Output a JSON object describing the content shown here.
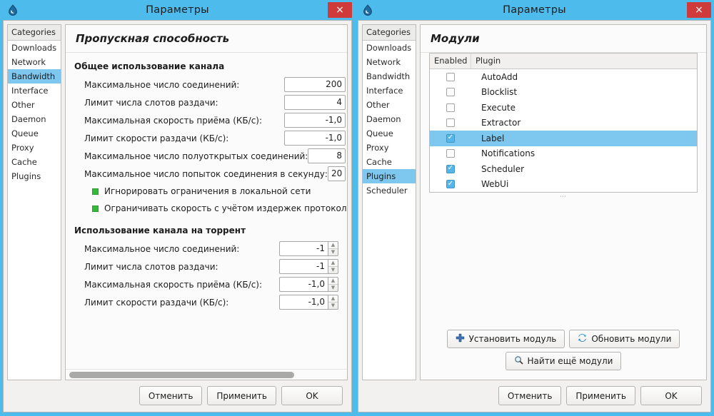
{
  "colors": {
    "titlebar": "#4dbbec",
    "close_button": "#cf3a3a",
    "selection": "#7ec8f0",
    "checkbox_checked": "#36b83a",
    "accent_blue": "#57b6e8"
  },
  "left_window": {
    "title": "Параметры",
    "app_icon": "deluge-droplet-icon",
    "close_label": "×",
    "sidebar": {
      "header": "Categories",
      "items": [
        {
          "label": "Downloads",
          "selected": false
        },
        {
          "label": "Network",
          "selected": false
        },
        {
          "label": "Bandwidth",
          "selected": true
        },
        {
          "label": "Interface",
          "selected": false
        },
        {
          "label": "Other",
          "selected": false
        },
        {
          "label": "Daemon",
          "selected": false
        },
        {
          "label": "Queue",
          "selected": false
        },
        {
          "label": "Proxy",
          "selected": false
        },
        {
          "label": "Cache",
          "selected": false
        },
        {
          "label": "Plugins",
          "selected": false
        }
      ]
    },
    "pane_title": "Пропускная способность",
    "group_global": {
      "title": "Общее использование канала",
      "rows": [
        {
          "label": "Максимальное число соединений:",
          "value": "200"
        },
        {
          "label": "Лимит числа слотов раздачи:",
          "value": "4"
        },
        {
          "label": "Максимальная скорость приёма (КБ/с):",
          "value": "-1,0"
        },
        {
          "label": "Лимит скорости раздачи (КБ/с):",
          "value": "-1,0"
        },
        {
          "label": "Максимальное число полуоткрытых соединений:",
          "value": "8"
        },
        {
          "label": "Максимальное число попыток соединения в секунду:",
          "value": "20"
        }
      ],
      "checkboxes": [
        {
          "label": "Игнорировать ограничения в локальной сети",
          "checked": true
        },
        {
          "label": "Ограничивать скорость с учётом издержек протокола IP",
          "checked": true
        }
      ]
    },
    "group_per_torrent": {
      "title": "Использование канала на торрент",
      "rows": [
        {
          "label": "Максимальное число соединений:",
          "value": "-1"
        },
        {
          "label": "Лимит числа слотов раздачи:",
          "value": "-1"
        },
        {
          "label": "Максимальная скорость приёма (КБ/с):",
          "value": "-1,0"
        },
        {
          "label": "Лимит скорости раздачи (КБ/с):",
          "value": "-1,0"
        }
      ]
    },
    "footer": {
      "cancel": "Отменить",
      "apply": "Применить",
      "ok": "OK"
    }
  },
  "right_window": {
    "title": "Параметры",
    "app_icon": "deluge-droplet-icon",
    "close_label": "×",
    "sidebar": {
      "header": "Categories",
      "items": [
        {
          "label": "Downloads",
          "selected": false
        },
        {
          "label": "Network",
          "selected": false
        },
        {
          "label": "Bandwidth",
          "selected": false
        },
        {
          "label": "Interface",
          "selected": false
        },
        {
          "label": "Other",
          "selected": false
        },
        {
          "label": "Daemon",
          "selected": false
        },
        {
          "label": "Queue",
          "selected": false
        },
        {
          "label": "Proxy",
          "selected": false
        },
        {
          "label": "Cache",
          "selected": false
        },
        {
          "label": "Plugins",
          "selected": true
        },
        {
          "label": "Scheduler",
          "selected": false
        }
      ]
    },
    "pane_title": "Модули",
    "table": {
      "columns": [
        "Enabled",
        "Plugin"
      ],
      "rows": [
        {
          "name": "AutoAdd",
          "enabled": false,
          "selected": false
        },
        {
          "name": "Blocklist",
          "enabled": false,
          "selected": false
        },
        {
          "name": "Execute",
          "enabled": false,
          "selected": false
        },
        {
          "name": "Extractor",
          "enabled": false,
          "selected": false
        },
        {
          "name": "Label",
          "enabled": true,
          "selected": true
        },
        {
          "name": "Notifications",
          "enabled": false,
          "selected": false
        },
        {
          "name": "Scheduler",
          "enabled": true,
          "selected": false
        },
        {
          "name": "WebUi",
          "enabled": true,
          "selected": false
        }
      ]
    },
    "actions": {
      "install": "Установить модуль",
      "install_icon": "plus-icon",
      "rescan": "Обновить модули",
      "rescan_icon": "refresh-icon",
      "find_more": "Найти ещё модули",
      "find_more_icon": "search-icon"
    },
    "footer": {
      "cancel": "Отменить",
      "apply": "Применить",
      "ok": "OK"
    }
  }
}
